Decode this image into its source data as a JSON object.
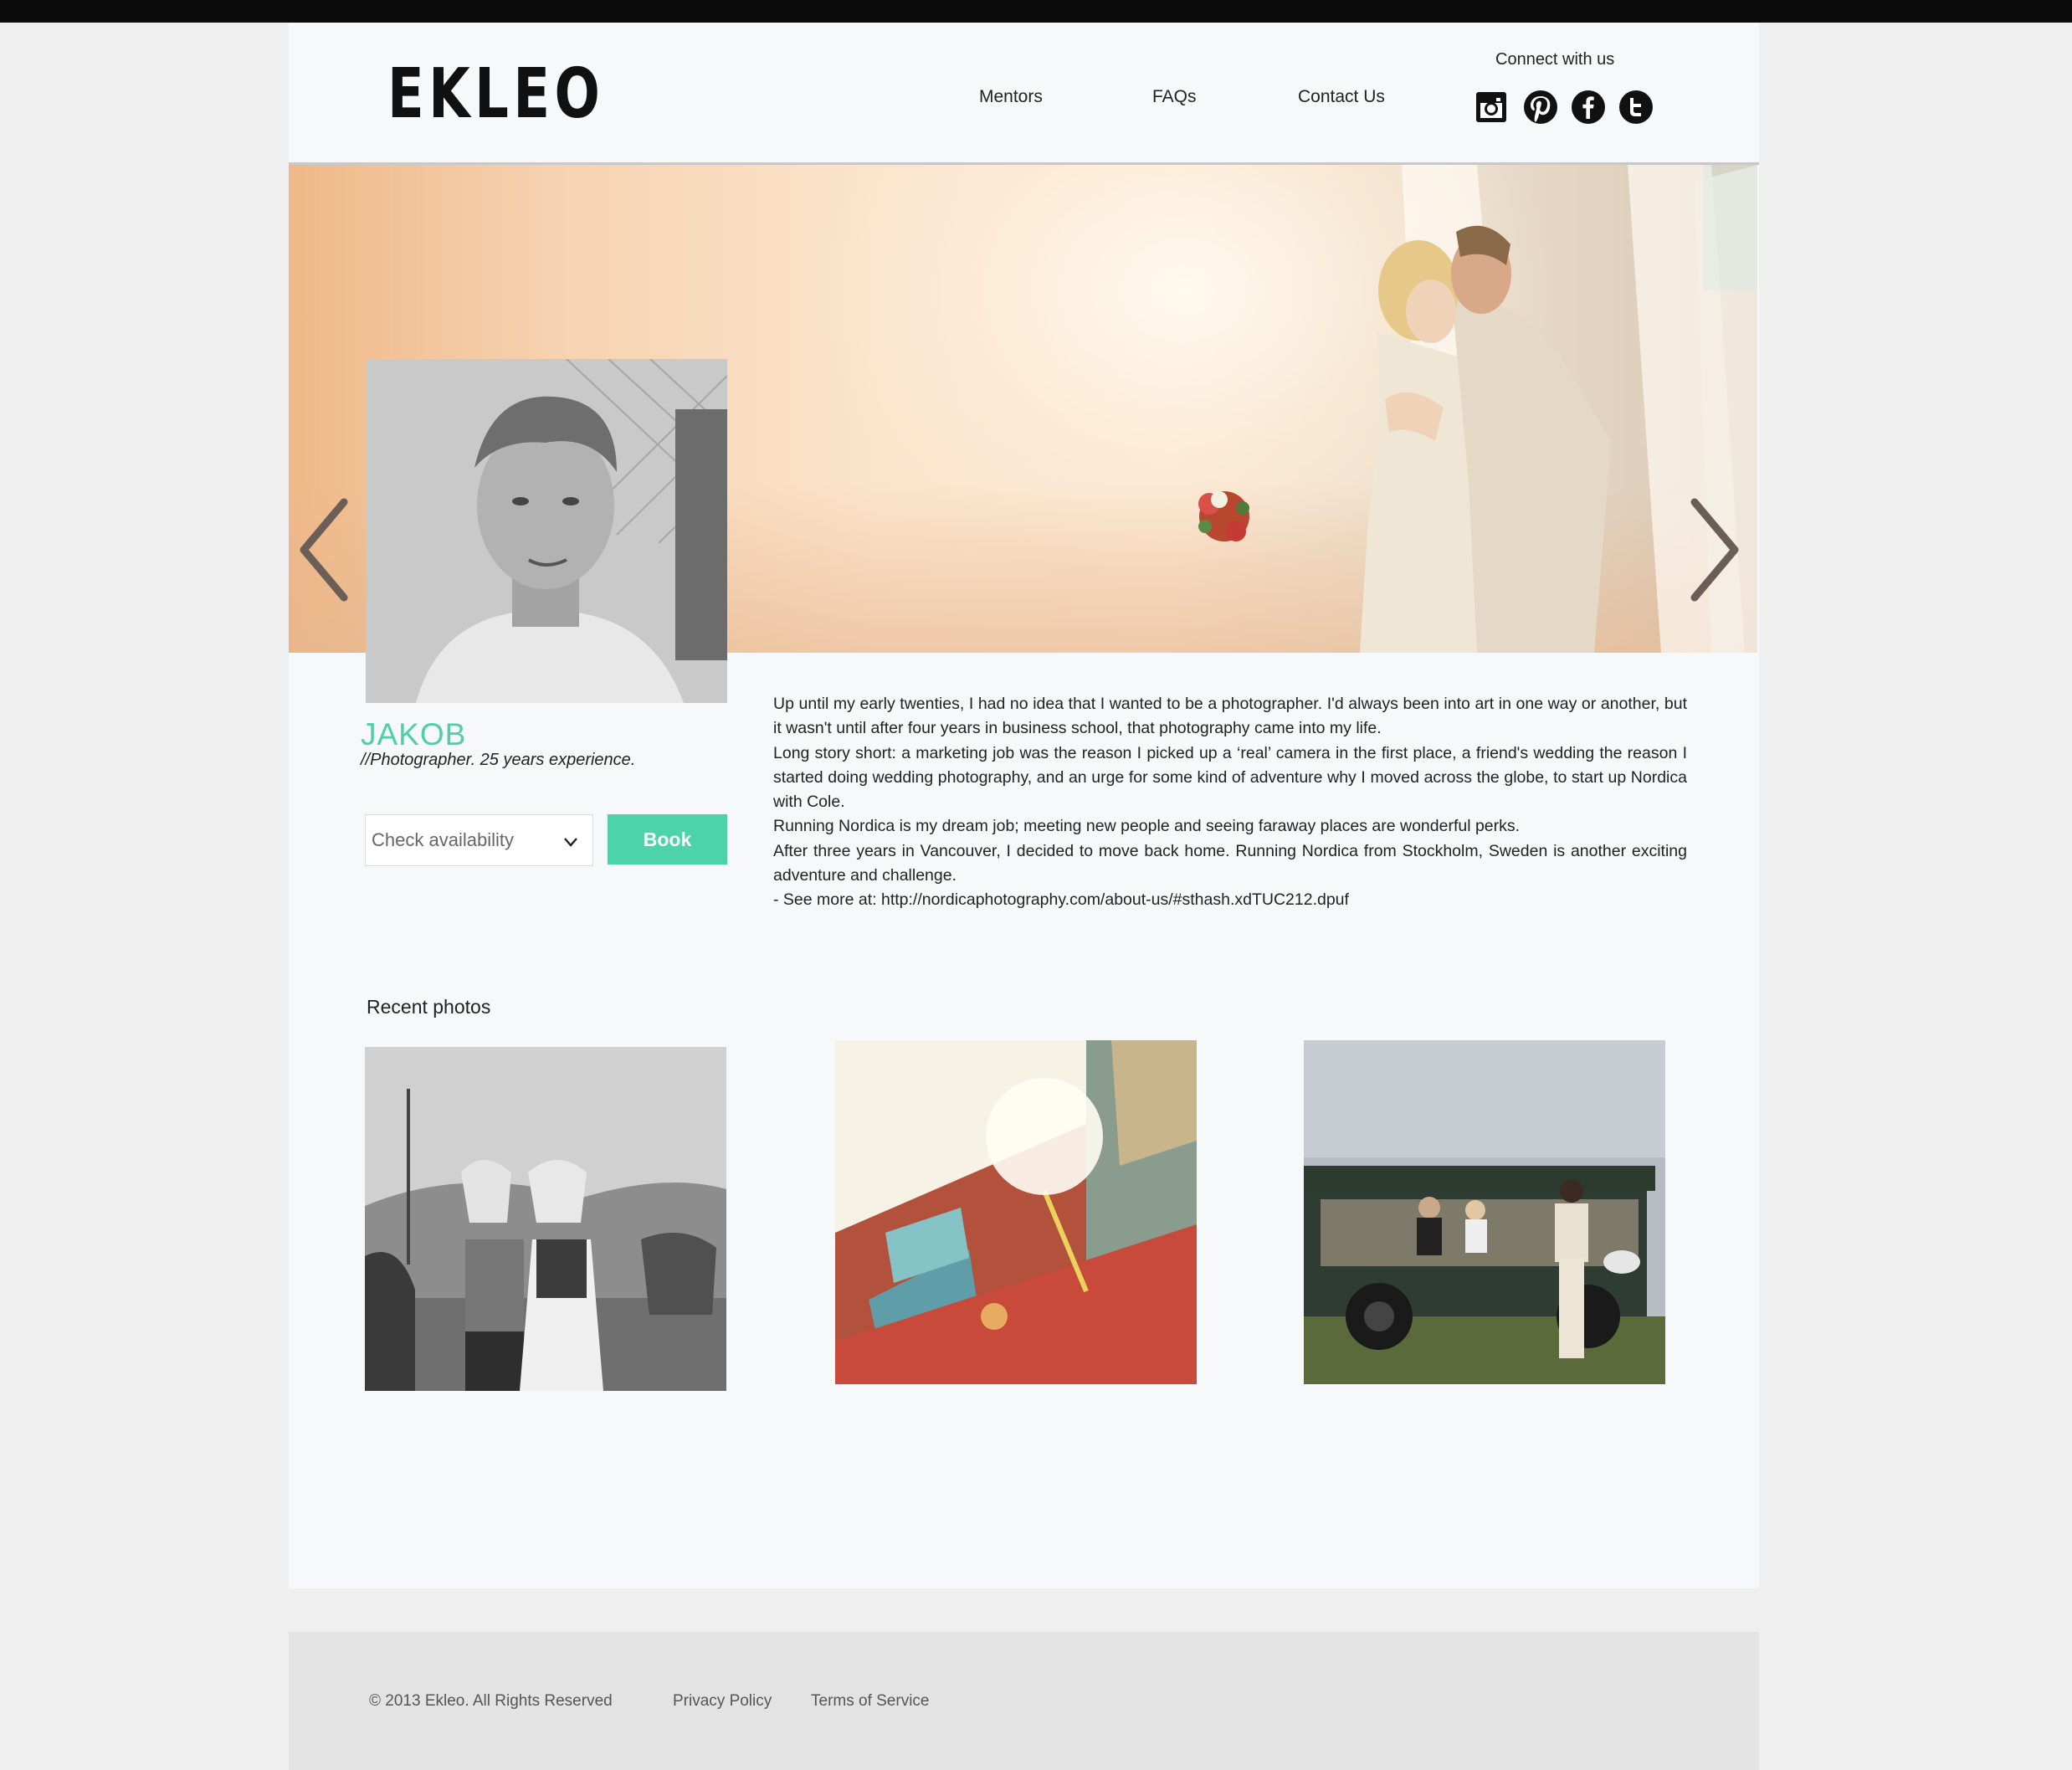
{
  "brand": {
    "logo": "EKLEO"
  },
  "nav": {
    "items": [
      "Mentors",
      "FAQs",
      "Contact Us"
    ]
  },
  "social": {
    "label": "Connect with us",
    "icons": [
      "instagram-icon",
      "pinterest-icon",
      "facebook-icon",
      "twitter-icon"
    ]
  },
  "hero": {
    "prev_icon": "chevron-left-icon",
    "next_icon": "chevron-right-icon"
  },
  "profile": {
    "name": "JAKOB",
    "subtitle": "//Photographer. 25 years experience.",
    "availability": {
      "selected": "Check availability",
      "icon": "chevron-down-icon"
    },
    "book_label": "Book"
  },
  "bio": {
    "paragraphs": [
      "Up until my early twenties, I had no idea that I wanted to be a photographer. I'd always been into art in one way or another, but it wasn't until after four years in business school, that photography came into my life.",
      "Long story short: a marketing job was the reason I picked up a ‘real’ camera in the first place, a friend's wedding the reason I started doing wedding photography, and an urge for some kind of adventure why I moved across the globe, to start up Nordica with Cole.",
      "Running Nordica is my dream job; meeting new people and seeing faraway places are wonderful perks.",
      "After three years in Vancouver, I decided to move back home. Running Nordica from Stockholm, Sweden is another exciting adventure and challenge.",
      "- See more at: http://nordicaphotography.com/about-us/#sthash.xdTUC212.dpuf"
    ]
  },
  "recent": {
    "title": "Recent photos"
  },
  "footer": {
    "copyright": "© 2013 Ekleo. All Rights Reserved",
    "privacy": "Privacy Policy",
    "terms": "Terms of Service"
  },
  "colors": {
    "accent": "#4dd3a8",
    "name": "#4ecfa6",
    "topbar": "#0b0b0b",
    "footer_bg": "#e3e3e3"
  }
}
